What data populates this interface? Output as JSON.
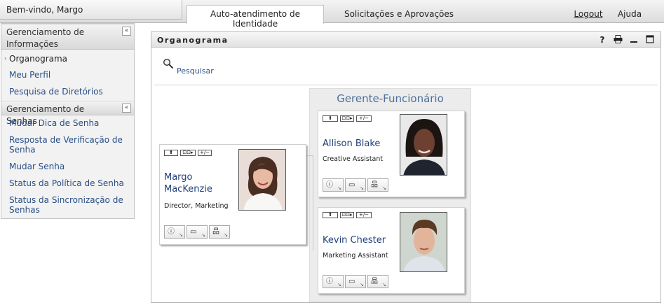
{
  "header": {
    "welcome": "Bem-vindo, Margo",
    "tabs": [
      {
        "label": "Auto-atendimento de Identidade",
        "active": true
      },
      {
        "label": "Solicitações e Aprovações",
        "active": false
      }
    ],
    "logout": "Logout",
    "help": "Ajuda"
  },
  "sidebar": {
    "sections": [
      {
        "title": "Gerenciamento de Informações",
        "items": [
          {
            "label": "Organograma",
            "active": true
          },
          {
            "label": "Meu Perfil",
            "active": false
          },
          {
            "label": "Pesquisa de Diretórios",
            "active": false
          }
        ]
      },
      {
        "title": "Gerenciamento de Senhas",
        "items": [
          {
            "label": "Mudar Dica de Senha"
          },
          {
            "label": "Resposta de Verificação de Senha"
          },
          {
            "label": "Mudar Senha"
          },
          {
            "label": "Status da Política de Senha"
          },
          {
            "label": "Status da Sincronização de Senhas"
          }
        ]
      }
    ],
    "collapse_glyph": "«"
  },
  "portlet": {
    "title": "Organograma",
    "icons": [
      "help-icon",
      "print-icon",
      "minimize-icon",
      "maximize-icon"
    ],
    "search_label": "Pesquisar"
  },
  "orgchart": {
    "group_title": "Gerente-Funcionário",
    "mini_buttons": [
      "⬆",
      "⊡⊡▸",
      "+/−"
    ],
    "root": {
      "name": "Margo MacKenzie",
      "title": "Director, Marketing"
    },
    "reports": [
      {
        "name": "Allison Blake",
        "title": "Creative Assistant"
      },
      {
        "name": "Kevin Chester",
        "title": "Marketing Assistant"
      }
    ],
    "actions": [
      "info-icon",
      "card-icon",
      "org-icon"
    ]
  },
  "colors": {
    "link": "#2a4f86",
    "group_title": "#4a6f99",
    "name": "#1f3f7a"
  }
}
